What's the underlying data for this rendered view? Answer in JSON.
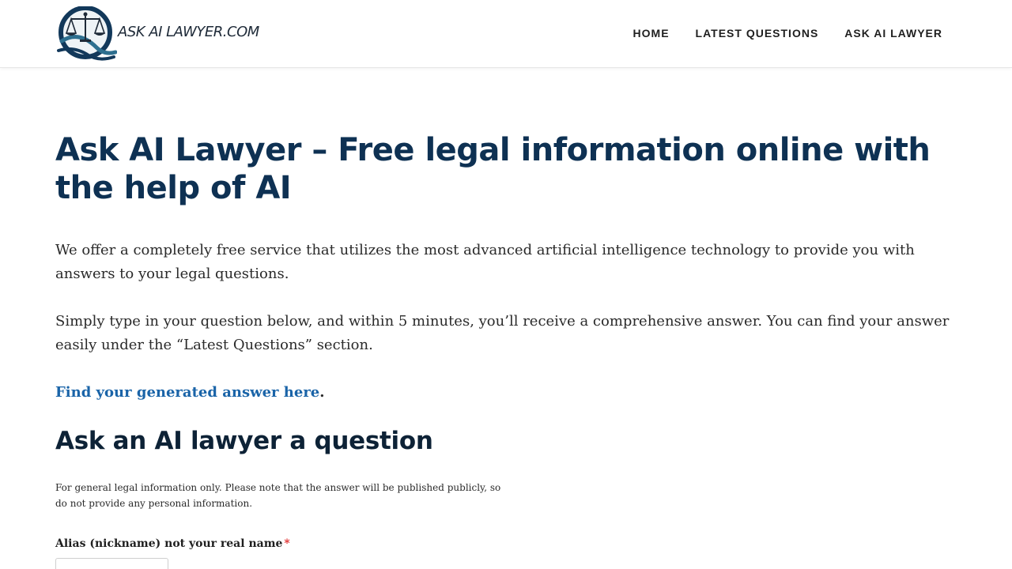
{
  "brand": {
    "logo_text": "ASK AI LAWYER.COM",
    "logo_icon": "scales-of-justice-icon",
    "colors": {
      "navy": "#0e3153",
      "ring": "#2d6f8f",
      "link": "#1a64a8",
      "required": "#e02b2b"
    }
  },
  "nav": {
    "items": [
      {
        "label": "HOME"
      },
      {
        "label": "LATEST QUESTIONS"
      },
      {
        "label": "ASK AI LAWYER"
      }
    ]
  },
  "main": {
    "title": "Ask AI Lawyer – Free legal information online with the help of AI",
    "intro1": "We offer a completely free service that utilizes the most advanced artificial intelligence technology to provide you with answers to your legal questions.",
    "intro2": "Simply type in your question below, and within 5 minutes, you’ll receive a comprehensive answer. You can find your answer easily under the “Latest Questions” section.",
    "answer_link": "Find your generated answer here",
    "answer_link_suffix": ".",
    "section_title": "Ask an AI lawyer a question",
    "disclaimer": "For general legal information only. Please note that the answer will be published publicly, so do not provide any personal information."
  },
  "form": {
    "alias_label": "Alias (nickname) not your real name",
    "required_mark": "*",
    "alias_value": ""
  }
}
